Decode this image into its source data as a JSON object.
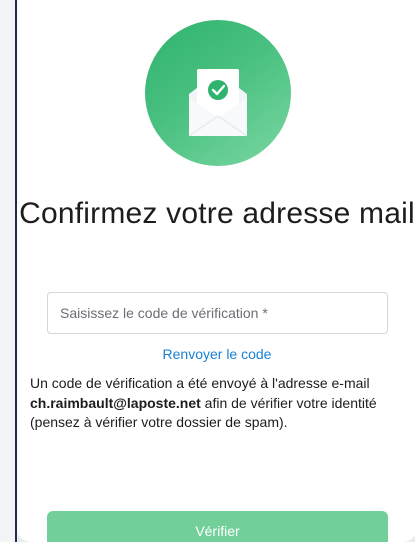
{
  "title": "Confirmez votre adresse mail",
  "code_input": {
    "value": "",
    "placeholder": "Saisissez le code de vérification *"
  },
  "resend_link": "Renvoyer le code",
  "message": {
    "before_email": "Un code de vérification a été envoyé à l'adresse e-mail ",
    "email": "ch.raimbault@laposte.net",
    "after_email": " afin de vérifier votre identité (pensez à vérifier votre dossier de spam)."
  },
  "verify_button": "Vérifier",
  "colors": {
    "accent_green": "#4cbf80",
    "button_green": "#72cf9a",
    "link_blue": "#1a7fd4",
    "text_dark": "#1d1d1f"
  },
  "icons": {
    "hero": "open-envelope-check-icon"
  }
}
